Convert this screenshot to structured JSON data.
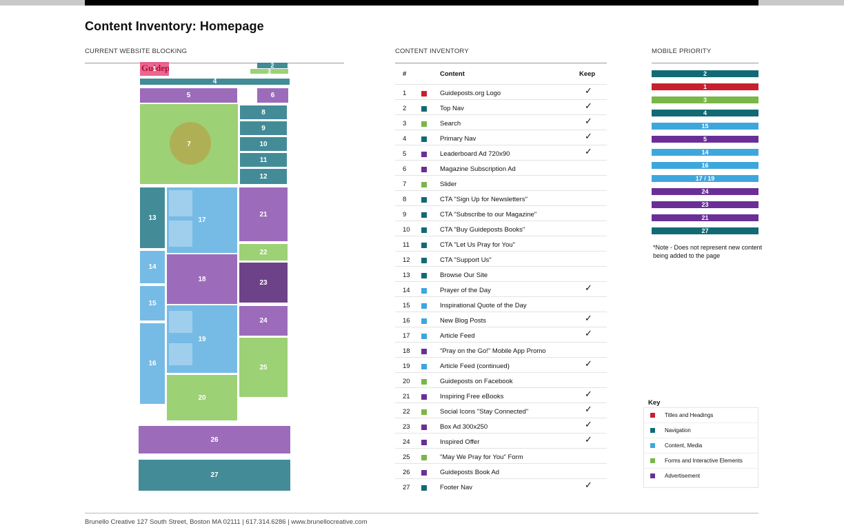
{
  "title": "Content Inventory: Homepage",
  "sections": {
    "blocking": "CURRENT WEBSITE BLOCKING",
    "inventory": "CONTENT INVENTORY",
    "mobile": "MOBILE PRIORITY"
  },
  "colors": {
    "titles": "#c8202f",
    "navigation": "#116a74",
    "content": "#3da7dd",
    "forms": "#7ab648",
    "advertisement": "#6a2f97"
  },
  "blocks": {
    "b1": "1",
    "b2": "2",
    "b3": "3",
    "b4": "4",
    "b5": "5",
    "b6": "6",
    "b7": "7",
    "b8": "8",
    "b9": "9",
    "b10": "10",
    "b11": "11",
    "b12": "12",
    "b13": "13",
    "b14": "14",
    "b15": "15",
    "b16": "16",
    "b17": "17",
    "b18": "18",
    "b19": "19",
    "b20": "20",
    "b21": "21",
    "b22": "22",
    "b23": "23",
    "b24": "24",
    "b25": "25",
    "b26": "26",
    "b27": "27"
  },
  "logo_text": "Guideposts",
  "inventory": {
    "headers": {
      "num": "#",
      "content": "Content",
      "keep": "Keep"
    },
    "rows": [
      {
        "num": "1",
        "label": "Guideposts.org Logo",
        "type": "titles",
        "keep": "✓"
      },
      {
        "num": "2",
        "label": "Top Nav",
        "type": "navigation",
        "keep": "✓"
      },
      {
        "num": "3",
        "label": "Search",
        "type": "forms",
        "keep": "✓"
      },
      {
        "num": "4",
        "label": "Primary Nav",
        "type": "navigation",
        "keep": "✓"
      },
      {
        "num": "5",
        "label": "Leaderboard Ad 720x90",
        "type": "advertisement",
        "keep": "✓"
      },
      {
        "num": "6",
        "label": "Magazine Subscription Ad",
        "type": "advertisement",
        "keep": ""
      },
      {
        "num": "7",
        "label": "Slider",
        "type": "forms",
        "keep": ""
      },
      {
        "num": "8",
        "label": "CTA \"Sign Up for Newsletters\"",
        "type": "navigation",
        "keep": ""
      },
      {
        "num": "9",
        "label": "CTA \"Subscribe to our Magazine\"",
        "type": "navigation",
        "keep": ""
      },
      {
        "num": "10",
        "label": "CTA \"Buy Guideposts Books\"",
        "type": "navigation",
        "keep": ""
      },
      {
        "num": "11",
        "label": "CTA \"Let Us Pray for You\"",
        "type": "navigation",
        "keep": ""
      },
      {
        "num": "12",
        "label": "CTA \"Support Us\"",
        "type": "navigation",
        "keep": ""
      },
      {
        "num": "13",
        "label": "Browse Our Site",
        "type": "navigation",
        "keep": ""
      },
      {
        "num": "14",
        "label": "Prayer of the Day",
        "type": "content",
        "keep": "✓"
      },
      {
        "num": "15",
        "label": "Inspirational Quote of the Day",
        "type": "content",
        "keep": ""
      },
      {
        "num": "16",
        "label": "New Blog Posts",
        "type": "content",
        "keep": "✓"
      },
      {
        "num": "17",
        "label": "Article Feed",
        "type": "content",
        "keep": "✓"
      },
      {
        "num": "18",
        "label": "\"Pray on the Go!\" Mobile App Promo",
        "type": "advertisement",
        "keep": ""
      },
      {
        "num": "19",
        "label": "Article Feed (continued)",
        "type": "content",
        "keep": "✓"
      },
      {
        "num": "20",
        "label": "Guideposts on Facebook",
        "type": "forms",
        "keep": ""
      },
      {
        "num": "21",
        "label": "Inspiring Free eBooks",
        "type": "advertisement",
        "keep": "✓"
      },
      {
        "num": "22",
        "label": "Social Icons \"Stay Connected\"",
        "type": "forms",
        "keep": "✓"
      },
      {
        "num": "23",
        "label": "Box Ad 300x250",
        "type": "advertisement",
        "keep": "✓"
      },
      {
        "num": "24",
        "label": "Inspired Offer",
        "type": "advertisement",
        "keep": "✓"
      },
      {
        "num": "25",
        "label": "\"May We Pray for You\" Form",
        "type": "forms",
        "keep": ""
      },
      {
        "num": "26",
        "label": "Guideposts Book Ad",
        "type": "advertisement",
        "keep": ""
      },
      {
        "num": "27",
        "label": "Footer Nav",
        "type": "navigation",
        "keep": "✓"
      }
    ]
  },
  "mobile_priority": [
    {
      "label": "2",
      "type": "navigation"
    },
    {
      "label": "1",
      "type": "titles"
    },
    {
      "label": "3",
      "type": "forms"
    },
    {
      "label": "4",
      "type": "navigation"
    },
    {
      "label": "15",
      "type": "content"
    },
    {
      "label": "5",
      "type": "advertisement"
    },
    {
      "label": "14",
      "type": "content"
    },
    {
      "label": "16",
      "type": "content"
    },
    {
      "label": "17 / 19",
      "type": "content"
    },
    {
      "label": "24",
      "type": "advertisement"
    },
    {
      "label": "23",
      "type": "advertisement"
    },
    {
      "label": "21",
      "type": "advertisement"
    },
    {
      "label": "27",
      "type": "navigation"
    }
  ],
  "note": "*Note - Does not represent new content being added to the page",
  "key": {
    "title": "Key",
    "items": [
      {
        "label": "Titles and Headings",
        "type": "titles"
      },
      {
        "label": "Navigation",
        "type": "navigation"
      },
      {
        "label": "Content, Media",
        "type": "content"
      },
      {
        "label": "Forms and Interactive Elements",
        "type": "forms"
      },
      {
        "label": "Advertisement",
        "type": "advertisement"
      }
    ]
  },
  "footer": "Brunello Creative 127 South Street, Boston MA 02111 | 617.314.6286 | www.brunellocreative.com"
}
